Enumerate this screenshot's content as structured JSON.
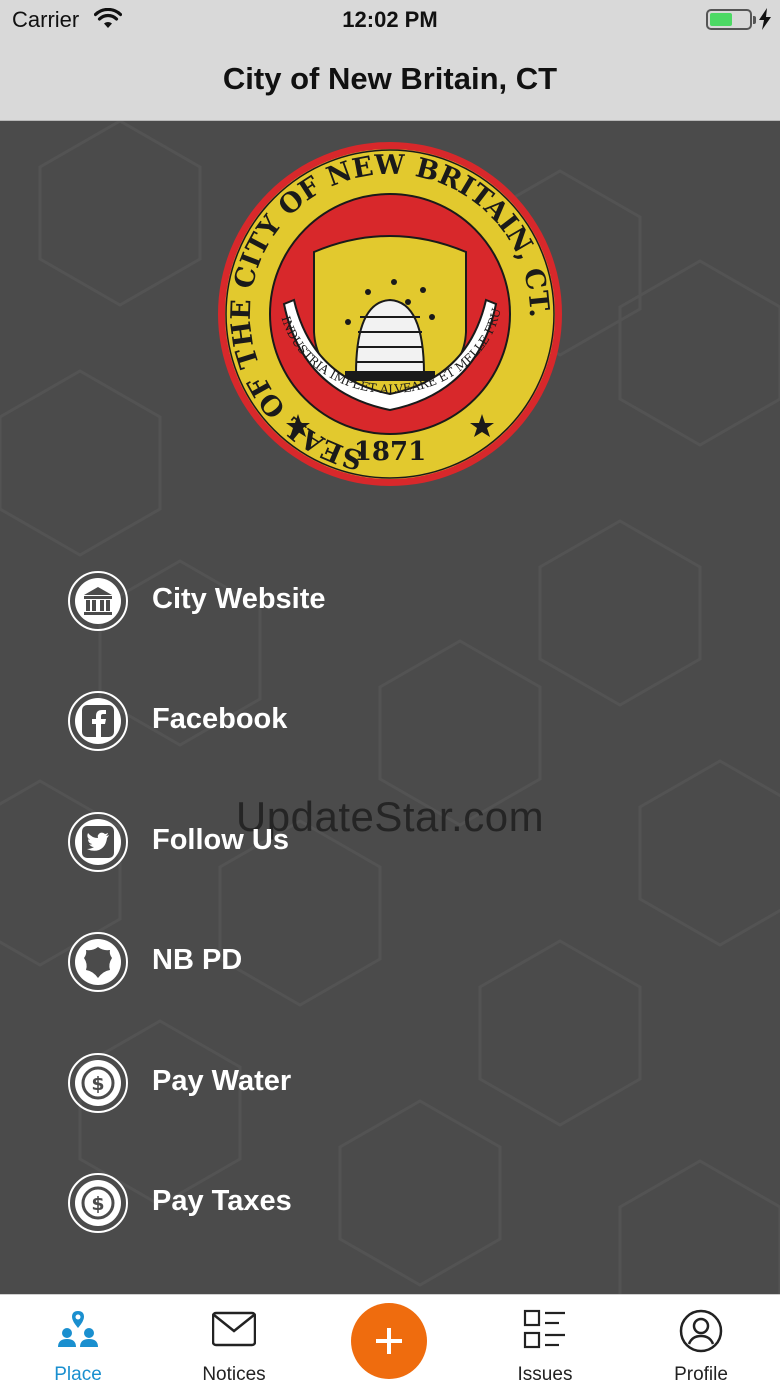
{
  "status_bar": {
    "carrier": "Carrier",
    "time": "12:02 PM",
    "battery_color": "#4cd964"
  },
  "nav_bar": {
    "title": "City of New Britain, CT"
  },
  "seal": {
    "ring_text": "SEAL OF THE CITY OF NEW BRITAIN, CT.",
    "motto": "INDUSTRIA IMPLET ALVEARE ET MELLE FRUITUR",
    "year": "1871"
  },
  "menu": {
    "items": [
      {
        "label": "City Website",
        "icon": "bank-icon"
      },
      {
        "label": "Facebook",
        "icon": "facebook-icon"
      },
      {
        "label": "Follow Us",
        "icon": "twitter-icon"
      },
      {
        "label": "NB PD",
        "icon": "police-badge-icon"
      },
      {
        "label": "Pay Water",
        "icon": "dollar-icon"
      },
      {
        "label": "Pay Taxes",
        "icon": "dollar-icon"
      }
    ]
  },
  "watermark": "UpdateStar.com",
  "tab_bar": {
    "tabs": [
      {
        "label": "Place",
        "icon": "place-icon",
        "active": true
      },
      {
        "label": "Notices",
        "icon": "envelope-icon",
        "active": false
      },
      {
        "label": "Issues",
        "icon": "list-icon",
        "active": false
      },
      {
        "label": "Profile",
        "icon": "profile-icon",
        "active": false
      }
    ],
    "add_icon": "plus-icon",
    "accent_color": "#1a8fcf",
    "add_button_color": "#ef6c0e"
  }
}
